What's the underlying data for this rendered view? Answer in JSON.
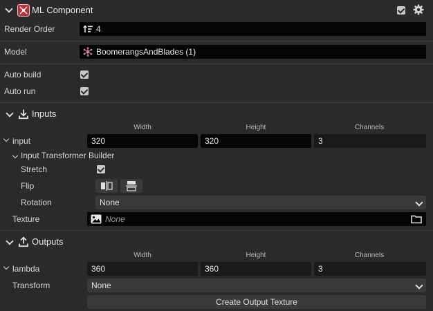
{
  "component": {
    "title": "ML Component",
    "icon": "ml-component-icon",
    "enabled": true
  },
  "render_order": {
    "label": "Render Order",
    "value": "4"
  },
  "model": {
    "label": "Model",
    "value": "BoomerangsAndBlades (1)"
  },
  "auto_build": {
    "label": "Auto build",
    "checked": true
  },
  "auto_run": {
    "label": "Auto run",
    "checked": true
  },
  "inputs": {
    "section_label": "Inputs",
    "columns": [
      "Width",
      "Height",
      "Channels"
    ],
    "input": {
      "label": "input",
      "width": "320",
      "height": "320",
      "channels": "3"
    },
    "transformer": {
      "label": "Input Transformer Builder",
      "stretch": {
        "label": "Stretch",
        "checked": true
      },
      "flip": {
        "label": "Flip"
      },
      "rotation": {
        "label": "Rotation",
        "value": "None"
      }
    },
    "texture": {
      "label": "Texture",
      "value": "None"
    }
  },
  "outputs": {
    "section_label": "Outputs",
    "columns": [
      "Width",
      "Height",
      "Channels"
    ],
    "lambda": {
      "label": "lambda",
      "width": "360",
      "height": "360",
      "channels": "3"
    },
    "transform": {
      "label": "Transform",
      "value": "None"
    },
    "create_texture_label": "Create Output Texture"
  },
  "colors": {
    "background": "#2b2b2d",
    "field": "#050505",
    "dropdown": "#3a3a3d",
    "separator": "#3d3d40"
  }
}
